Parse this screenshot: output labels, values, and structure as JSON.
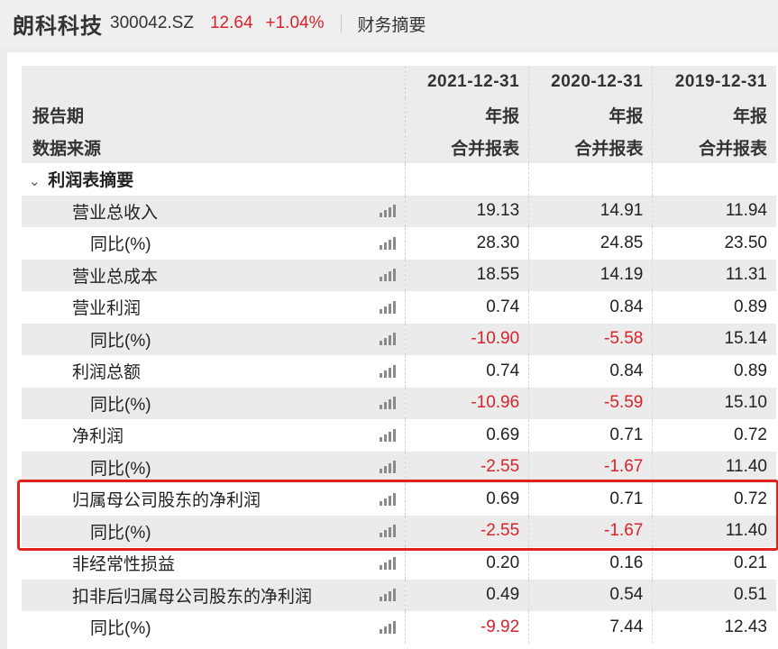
{
  "header": {
    "stock_name": "朗科科技",
    "stock_code": "300042.SZ",
    "price": "12.64",
    "change": "+1.04%",
    "section": "财务摘要"
  },
  "table": {
    "row_labels": {
      "period": "报告期",
      "source": "数据来源"
    },
    "columns": [
      {
        "date": "2021-12-31",
        "type": "年报",
        "source": "合并报表"
      },
      {
        "date": "2020-12-31",
        "type": "年报",
        "source": "合并报表"
      },
      {
        "date": "2019-12-31",
        "type": "年报",
        "source": "合并报表"
      }
    ],
    "section_title": "利润表摘要",
    "rows": [
      {
        "label": "营业总收入",
        "values": [
          "19.13",
          "14.91",
          "11.94"
        ]
      },
      {
        "label": "同比(%)",
        "values": [
          "28.30",
          "24.85",
          "23.50"
        ]
      },
      {
        "label": "营业总成本",
        "values": [
          "18.55",
          "14.19",
          "11.31"
        ]
      },
      {
        "label": "营业利润",
        "values": [
          "0.74",
          "0.84",
          "0.89"
        ]
      },
      {
        "label": "同比(%)",
        "values": [
          "-10.90",
          "-5.58",
          "15.14"
        ]
      },
      {
        "label": "利润总额",
        "values": [
          "0.74",
          "0.84",
          "0.89"
        ]
      },
      {
        "label": "同比(%)",
        "values": [
          "-10.96",
          "-5.59",
          "15.10"
        ]
      },
      {
        "label": "净利润",
        "values": [
          "0.69",
          "0.71",
          "0.72"
        ]
      },
      {
        "label": "同比(%)",
        "values": [
          "-2.55",
          "-1.67",
          "11.40"
        ]
      },
      {
        "label": "归属母公司股东的净利润",
        "values": [
          "0.69",
          "0.71",
          "0.72"
        ]
      },
      {
        "label": "同比(%)",
        "values": [
          "-2.55",
          "-1.67",
          "11.40"
        ]
      },
      {
        "label": "非经常性损益",
        "values": [
          "0.20",
          "0.16",
          "0.21"
        ]
      },
      {
        "label": "扣非后归属母公司股东的净利润",
        "values": [
          "0.49",
          "0.54",
          "0.51"
        ]
      },
      {
        "label": "同比(%)",
        "values": [
          "-9.92",
          "7.44",
          "12.43"
        ]
      }
    ]
  },
  "colors": {
    "negative": "#d8232a",
    "highlight_border": "#e0231f"
  },
  "icons": {
    "row_chart": "bar-chart-icon",
    "section_toggle": "chevron-down-icon"
  }
}
